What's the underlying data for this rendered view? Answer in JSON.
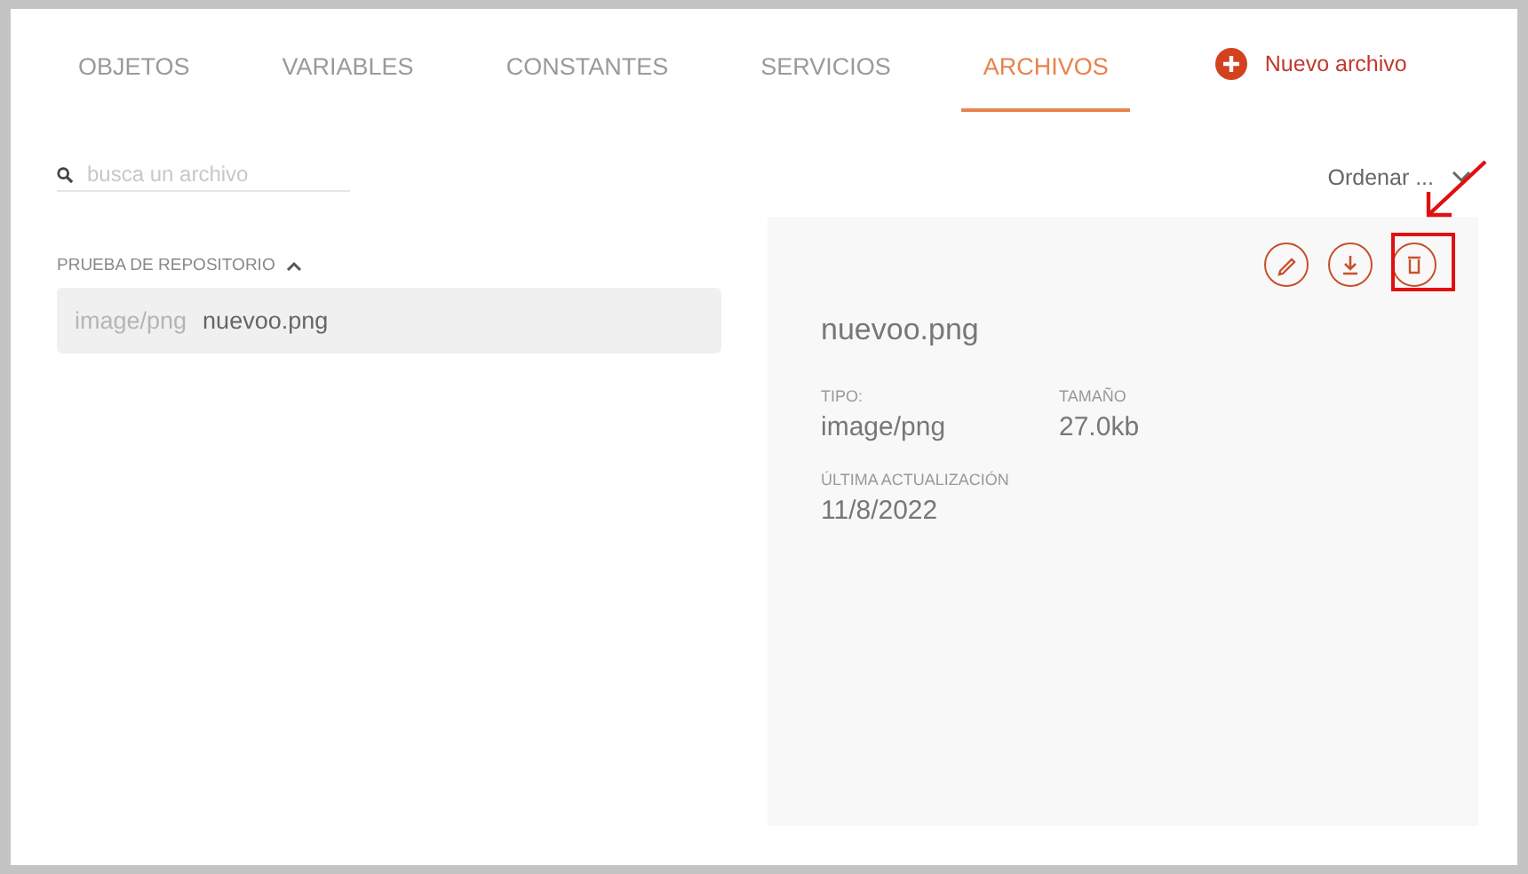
{
  "tabs": [
    {
      "label": "OBJETOS",
      "selected": false
    },
    {
      "label": "VARIABLES",
      "selected": false
    },
    {
      "label": "CONSTANTES",
      "selected": false
    },
    {
      "label": "SERVICIOS",
      "selected": false
    },
    {
      "label": "ARCHIVOS",
      "selected": true
    }
  ],
  "new_file_button": {
    "label": "Nuevo archivo"
  },
  "search": {
    "placeholder": "busca un archivo"
  },
  "sort": {
    "label": "Ordenar ..."
  },
  "groups": [
    {
      "title": "PRUEBA DE REPOSITORIO",
      "expanded": true,
      "files": [
        {
          "type": "image/png",
          "name": "nuevoo.png",
          "selected": true
        }
      ]
    }
  ],
  "detail": {
    "title": "nuevoo.png",
    "actions": [
      {
        "kind": "edit",
        "highlighted": false
      },
      {
        "kind": "download",
        "highlighted": false
      },
      {
        "kind": "delete",
        "highlighted": true
      }
    ],
    "fields": [
      {
        "label": "TIPO:",
        "value": "image/png"
      },
      {
        "label": "TAMAÑO",
        "value": "27.0kb"
      },
      {
        "label": "ÚLTIMA ACTUALIZACIÓN",
        "value": "11/8/2022"
      }
    ]
  }
}
